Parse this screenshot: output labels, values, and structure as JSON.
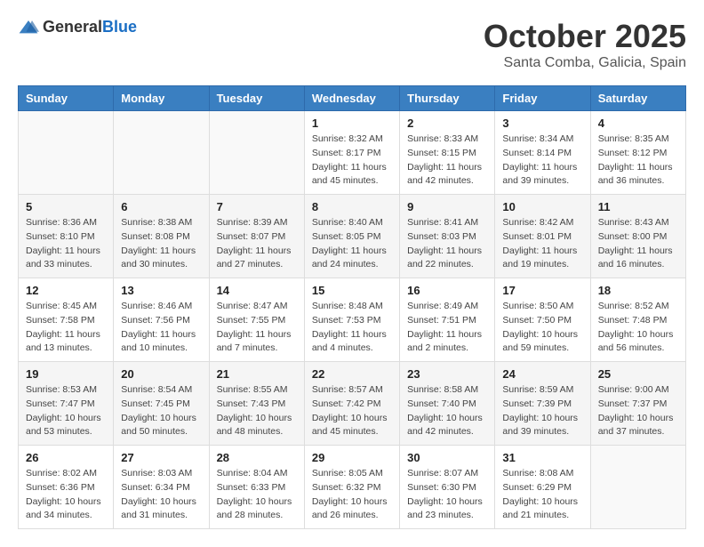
{
  "header": {
    "logo_general": "General",
    "logo_blue": "Blue",
    "month": "October 2025",
    "location": "Santa Comba, Galicia, Spain"
  },
  "weekdays": [
    "Sunday",
    "Monday",
    "Tuesday",
    "Wednesday",
    "Thursday",
    "Friday",
    "Saturday"
  ],
  "weeks": [
    [
      {
        "day": "",
        "info": ""
      },
      {
        "day": "",
        "info": ""
      },
      {
        "day": "",
        "info": ""
      },
      {
        "day": "1",
        "info": "Sunrise: 8:32 AM\nSunset: 8:17 PM\nDaylight: 11 hours and 45 minutes."
      },
      {
        "day": "2",
        "info": "Sunrise: 8:33 AM\nSunset: 8:15 PM\nDaylight: 11 hours and 42 minutes."
      },
      {
        "day": "3",
        "info": "Sunrise: 8:34 AM\nSunset: 8:14 PM\nDaylight: 11 hours and 39 minutes."
      },
      {
        "day": "4",
        "info": "Sunrise: 8:35 AM\nSunset: 8:12 PM\nDaylight: 11 hours and 36 minutes."
      }
    ],
    [
      {
        "day": "5",
        "info": "Sunrise: 8:36 AM\nSunset: 8:10 PM\nDaylight: 11 hours and 33 minutes."
      },
      {
        "day": "6",
        "info": "Sunrise: 8:38 AM\nSunset: 8:08 PM\nDaylight: 11 hours and 30 minutes."
      },
      {
        "day": "7",
        "info": "Sunrise: 8:39 AM\nSunset: 8:07 PM\nDaylight: 11 hours and 27 minutes."
      },
      {
        "day": "8",
        "info": "Sunrise: 8:40 AM\nSunset: 8:05 PM\nDaylight: 11 hours and 24 minutes."
      },
      {
        "day": "9",
        "info": "Sunrise: 8:41 AM\nSunset: 8:03 PM\nDaylight: 11 hours and 22 minutes."
      },
      {
        "day": "10",
        "info": "Sunrise: 8:42 AM\nSunset: 8:01 PM\nDaylight: 11 hours and 19 minutes."
      },
      {
        "day": "11",
        "info": "Sunrise: 8:43 AM\nSunset: 8:00 PM\nDaylight: 11 hours and 16 minutes."
      }
    ],
    [
      {
        "day": "12",
        "info": "Sunrise: 8:45 AM\nSunset: 7:58 PM\nDaylight: 11 hours and 13 minutes."
      },
      {
        "day": "13",
        "info": "Sunrise: 8:46 AM\nSunset: 7:56 PM\nDaylight: 11 hours and 10 minutes."
      },
      {
        "day": "14",
        "info": "Sunrise: 8:47 AM\nSunset: 7:55 PM\nDaylight: 11 hours and 7 minutes."
      },
      {
        "day": "15",
        "info": "Sunrise: 8:48 AM\nSunset: 7:53 PM\nDaylight: 11 hours and 4 minutes."
      },
      {
        "day": "16",
        "info": "Sunrise: 8:49 AM\nSunset: 7:51 PM\nDaylight: 11 hours and 2 minutes."
      },
      {
        "day": "17",
        "info": "Sunrise: 8:50 AM\nSunset: 7:50 PM\nDaylight: 10 hours and 59 minutes."
      },
      {
        "day": "18",
        "info": "Sunrise: 8:52 AM\nSunset: 7:48 PM\nDaylight: 10 hours and 56 minutes."
      }
    ],
    [
      {
        "day": "19",
        "info": "Sunrise: 8:53 AM\nSunset: 7:47 PM\nDaylight: 10 hours and 53 minutes."
      },
      {
        "day": "20",
        "info": "Sunrise: 8:54 AM\nSunset: 7:45 PM\nDaylight: 10 hours and 50 minutes."
      },
      {
        "day": "21",
        "info": "Sunrise: 8:55 AM\nSunset: 7:43 PM\nDaylight: 10 hours and 48 minutes."
      },
      {
        "day": "22",
        "info": "Sunrise: 8:57 AM\nSunset: 7:42 PM\nDaylight: 10 hours and 45 minutes."
      },
      {
        "day": "23",
        "info": "Sunrise: 8:58 AM\nSunset: 7:40 PM\nDaylight: 10 hours and 42 minutes."
      },
      {
        "day": "24",
        "info": "Sunrise: 8:59 AM\nSunset: 7:39 PM\nDaylight: 10 hours and 39 minutes."
      },
      {
        "day": "25",
        "info": "Sunrise: 9:00 AM\nSunset: 7:37 PM\nDaylight: 10 hours and 37 minutes."
      }
    ],
    [
      {
        "day": "26",
        "info": "Sunrise: 8:02 AM\nSunset: 6:36 PM\nDaylight: 10 hours and 34 minutes."
      },
      {
        "day": "27",
        "info": "Sunrise: 8:03 AM\nSunset: 6:34 PM\nDaylight: 10 hours and 31 minutes."
      },
      {
        "day": "28",
        "info": "Sunrise: 8:04 AM\nSunset: 6:33 PM\nDaylight: 10 hours and 28 minutes."
      },
      {
        "day": "29",
        "info": "Sunrise: 8:05 AM\nSunset: 6:32 PM\nDaylight: 10 hours and 26 minutes."
      },
      {
        "day": "30",
        "info": "Sunrise: 8:07 AM\nSunset: 6:30 PM\nDaylight: 10 hours and 23 minutes."
      },
      {
        "day": "31",
        "info": "Sunrise: 8:08 AM\nSunset: 6:29 PM\nDaylight: 10 hours and 21 minutes."
      },
      {
        "day": "",
        "info": ""
      }
    ]
  ]
}
